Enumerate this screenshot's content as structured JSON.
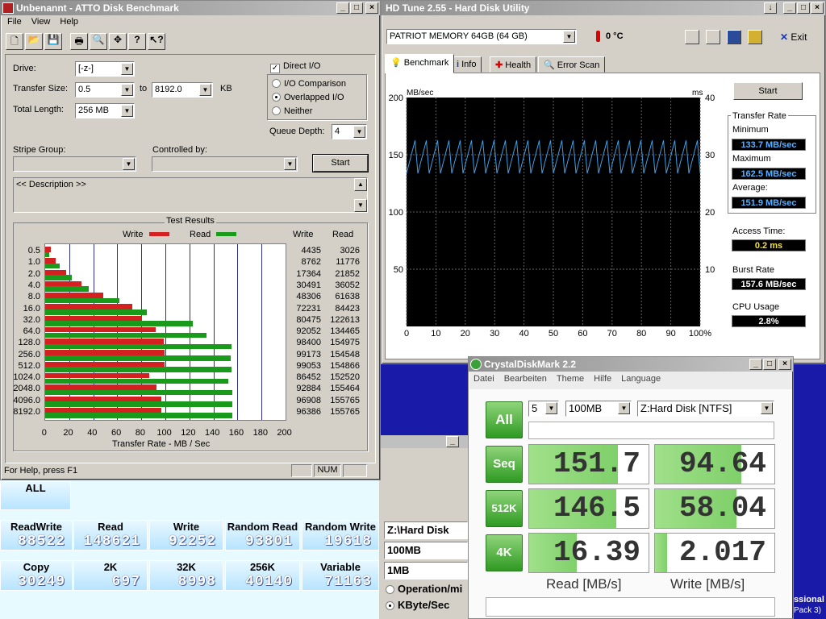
{
  "atto": {
    "title": "Unbenannt - ATTO Disk Benchmark",
    "menu": [
      "File",
      "View",
      "Help"
    ],
    "drive_label": "Drive:",
    "drive_value": "[-z-]",
    "transfer_size_label": "Transfer Size:",
    "transfer_from": "0.5",
    "to_label": "to",
    "transfer_to": "8192.0",
    "kb_label": "KB",
    "total_length_label": "Total Length:",
    "total_length_value": "256 MB",
    "direct_io_label": "Direct I/O",
    "io_comparison_label": "I/O Comparison",
    "overlapped_io_label": "Overlapped I/O",
    "neither_label": "Neither",
    "queue_depth_label": "Queue Depth:",
    "queue_depth_value": "4",
    "stripe_group_label": "Stripe Group:",
    "controlled_by_label": "Controlled by:",
    "start_label": "Start",
    "description": "<< Description >>",
    "test_results_label": "Test Results",
    "write_legend": "Write",
    "read_legend": "Read",
    "col_write": "Write",
    "col_read": "Read",
    "status_text": "For Help, press F1",
    "num_label": "NUM",
    "colors": {
      "write": "#d42020",
      "read": "#1a9a1a"
    }
  },
  "chart_data": {
    "type": "bar",
    "orientation": "horizontal",
    "categories": [
      "0.5",
      "1.0",
      "2.0",
      "4.0",
      "8.0",
      "16.0",
      "32.0",
      "64.0",
      "128.0",
      "256.0",
      "512.0",
      "1024.0",
      "2048.0",
      "4096.0",
      "8192.0"
    ],
    "series": [
      {
        "name": "Write",
        "values": [
          4.4,
          8.8,
          17.4,
          30.5,
          48.3,
          72.2,
          80.5,
          92.1,
          98.4,
          99.2,
          99.1,
          86.5,
          92.9,
          96.9,
          96.4
        ],
        "raw": [
          "4435",
          "8762",
          "17364",
          "30491",
          "48306",
          "72231",
          "80475",
          "92052",
          "98400",
          "99173",
          "99053",
          "86452",
          "92884",
          "96908",
          "96386"
        ]
      },
      {
        "name": "Read",
        "values": [
          3.0,
          11.8,
          21.9,
          36.1,
          61.6,
          84.4,
          122.6,
          134.5,
          155.0,
          154.5,
          154.9,
          152.5,
          155.5,
          155.8,
          155.8
        ],
        "raw": [
          "3026",
          "11776",
          "21852",
          "36052",
          "61638",
          "84423",
          "122613",
          "134465",
          "154975",
          "154548",
          "154866",
          "152520",
          "155464",
          "155765",
          "155765"
        ]
      }
    ],
    "xlabel": "Transfer Rate - MB / Sec",
    "xlim": [
      0,
      200
    ],
    "xticks": [
      "0",
      "20",
      "40",
      "60",
      "80",
      "100",
      "120",
      "140",
      "160",
      "180",
      "200"
    ],
    "grid": true
  },
  "hdtune": {
    "title": "HD Tune 2.55 - Hard Disk Utility",
    "drive": "PATRIOT MEMORY 64GB (64 GB)",
    "temp": "0 °C",
    "exit_label": "Exit",
    "tabs": [
      "Benchmark",
      "Info",
      "Health",
      "Error Scan"
    ],
    "y_left_label": "MB/sec",
    "y_right_label": "ms",
    "y_left_ticks": [
      "200",
      "150",
      "100",
      "50"
    ],
    "y_right_ticks": [
      "40",
      "30",
      "20",
      "10"
    ],
    "x_ticks": [
      "0",
      "10",
      "20",
      "30",
      "40",
      "50",
      "60",
      "70",
      "80",
      "90",
      "100%"
    ],
    "start_label": "Start",
    "transfer_rate_label": "Transfer Rate",
    "minimum_label": "Minimum",
    "minimum_value": "133.7 MB/sec",
    "maximum_label": "Maximum",
    "maximum_value": "162.5 MB/sec",
    "average_label": "Average:",
    "average_value": "151.9 MB/sec",
    "access_time_label": "Access Time:",
    "access_time_value": "0.2 ms",
    "burst_rate_label": "Burst Rate",
    "burst_rate_value": "157.6 MB/sec",
    "cpu_usage_label": "CPU Usage",
    "cpu_usage_value": "2.8%",
    "line_color": "#3aa0e8",
    "trace": {
      "min": 133.7,
      "max": 162.5,
      "cycles": 26
    }
  },
  "crystal": {
    "title": "CrystalDiskMark 2.2",
    "menu": [
      "Datei",
      "Bearbeiten",
      "Theme",
      "Hilfe",
      "Language"
    ],
    "all_label": "All",
    "count_value": "5",
    "size_value": "100MB",
    "drive_value": "Z:Hard Disk [NTFS]",
    "rows": [
      {
        "label": "Seq",
        "read": "151.7",
        "write": "94.64",
        "read_pct": 0.74,
        "write_pct": 0.72
      },
      {
        "label": "512K",
        "read": "146.5",
        "write": "58.04",
        "read_pct": 0.73,
        "write_pct": 0.68
      },
      {
        "label": "4K",
        "read": "16.39",
        "write": "2.017",
        "read_pct": 0.4,
        "write_pct": 0.1
      }
    ],
    "read_footer": "Read [MB/s]",
    "write_footer": "Write [MB/s]"
  },
  "bench": {
    "all_label": "ALL",
    "row1": [
      {
        "h": "ReadWrite",
        "v": "88522"
      },
      {
        "h": "Read",
        "v": "148621"
      },
      {
        "h": "Write",
        "v": "92252"
      },
      {
        "h": "Random Read",
        "v": "93801"
      },
      {
        "h": "Random Write",
        "v": "19618"
      }
    ],
    "row2": [
      {
        "h": "Copy",
        "v": "30249"
      },
      {
        "h": "2K",
        "v": "697"
      },
      {
        "h": "32K",
        "v": "8998"
      },
      {
        "h": "256K",
        "v": "40140"
      },
      {
        "h": "Variable",
        "v": "71163"
      }
    ],
    "drive_value": "Z:\\Hard Disk",
    "size_value": "100MB",
    "block_value": "1MB",
    "opt1": "Operation/mi",
    "opt2": "KByte/Sec"
  },
  "desktop": {
    "edge_text1": "ssional",
    "edge_text2": "Pack 3)"
  }
}
